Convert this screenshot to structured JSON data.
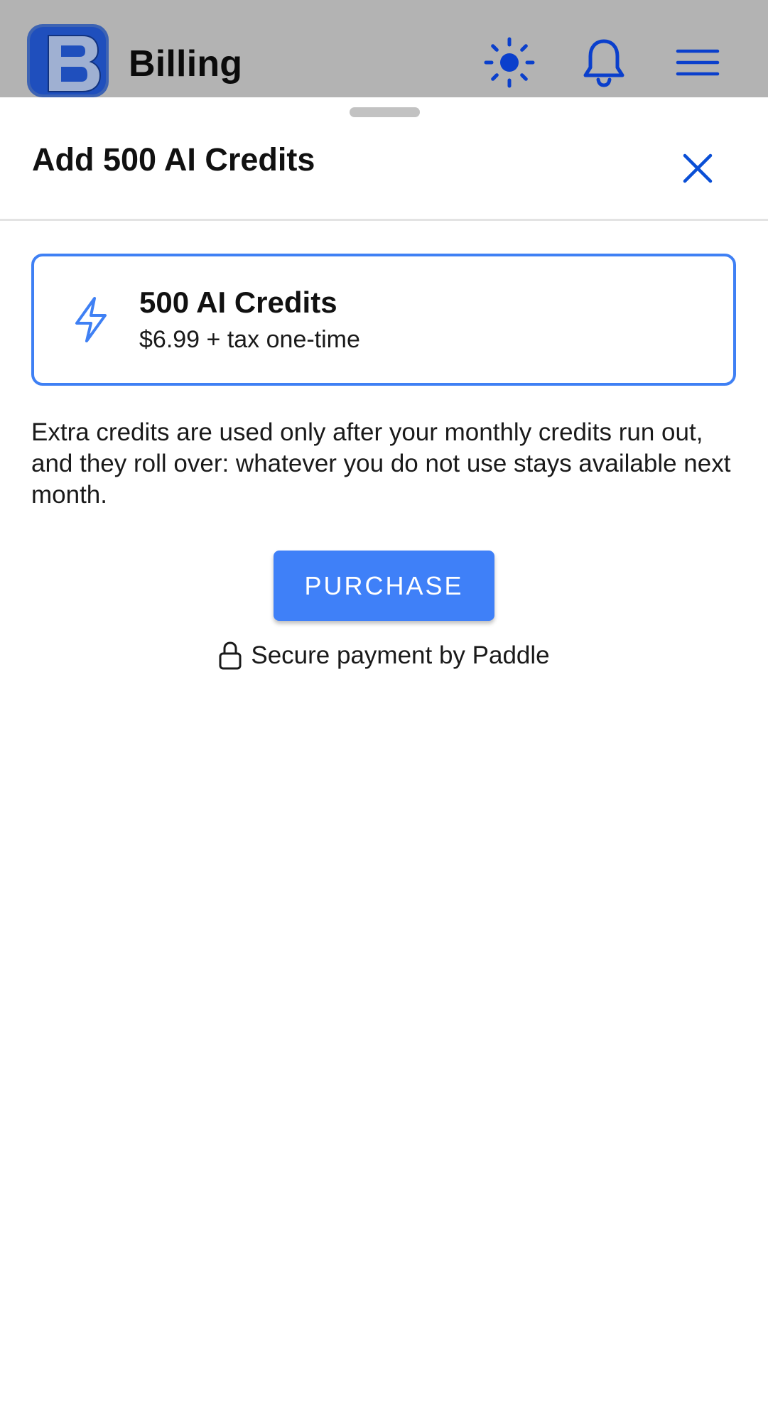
{
  "app_header": {
    "title": "Billing",
    "logo_letter": "B",
    "icons": [
      "sun-icon",
      "bell-icon",
      "menu-icon"
    ]
  },
  "sheet": {
    "title": "Add 500 AI Credits",
    "close_icon": "close-icon"
  },
  "product": {
    "icon": "lightning-bolt-icon",
    "name": "500 AI Credits",
    "price": "$6.99 + tax one-time"
  },
  "description": "Extra credits are used only after your monthly credits run out, and they roll over: whatever you do not use stays available next month.",
  "purchase_label": "PURCHASE",
  "secure_note": "Secure payment by Paddle",
  "colors": {
    "accent": "#3f80f4",
    "header_icons": "#0a3fcc",
    "overlay": "#b3b3b3"
  }
}
